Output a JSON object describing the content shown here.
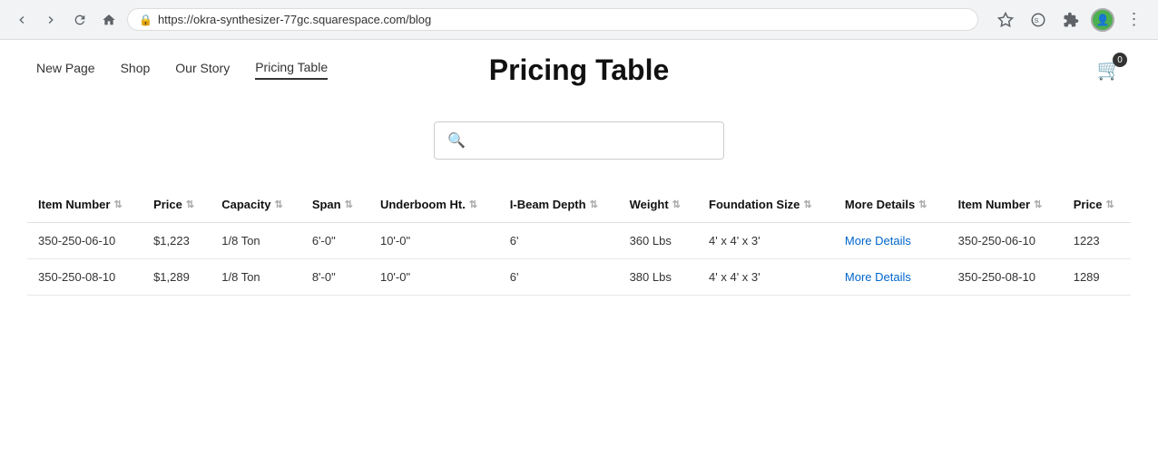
{
  "browser": {
    "url": "https://okra-synthesizer-77gc.squarespace.com/blog",
    "star_title": "Bookmark",
    "extensions_title": "Extensions"
  },
  "header": {
    "page_title": "Pricing Table",
    "nav_items": [
      {
        "label": "New Page",
        "active": false
      },
      {
        "label": "Shop",
        "active": false
      },
      {
        "label": "Our Story",
        "active": false
      },
      {
        "label": "Pricing Table",
        "active": true
      }
    ],
    "cart_count": "0"
  },
  "search": {
    "placeholder": ""
  },
  "table": {
    "columns": [
      {
        "id": "item_number",
        "label": "Item Number"
      },
      {
        "id": "price",
        "label": "Price"
      },
      {
        "id": "capacity",
        "label": "Capacity"
      },
      {
        "id": "span",
        "label": "Span"
      },
      {
        "id": "underboom_ht",
        "label": "Underboom Ht."
      },
      {
        "id": "ibeam_depth",
        "label": "I-Beam Depth"
      },
      {
        "id": "weight",
        "label": "Weight"
      },
      {
        "id": "foundation_size",
        "label": "Foundation Size"
      },
      {
        "id": "more_details",
        "label": "More Details"
      },
      {
        "id": "item_number2",
        "label": "Item Number"
      },
      {
        "id": "price2",
        "label": "Price"
      }
    ],
    "rows": [
      {
        "item_number": "350-250-06-10",
        "price": "$1,223",
        "capacity": "1/8 Ton",
        "span": "6'-0\"",
        "underboom_ht": "10'-0\"",
        "ibeam_depth": "6'",
        "weight": "360 Lbs",
        "foundation_size": "4' x 4' x 3'",
        "more_details_label": "More Details",
        "item_number2": "350-250-06-10",
        "price2": "1223"
      },
      {
        "item_number": "350-250-08-10",
        "price": "$1,289",
        "capacity": "1/8 Ton",
        "span": "8'-0\"",
        "underboom_ht": "10'-0\"",
        "ibeam_depth": "6'",
        "weight": "380 Lbs",
        "foundation_size": "4' x 4' x 3'",
        "more_details_label": "More Details",
        "item_number2": "350-250-08-10",
        "price2": "1289"
      }
    ]
  }
}
